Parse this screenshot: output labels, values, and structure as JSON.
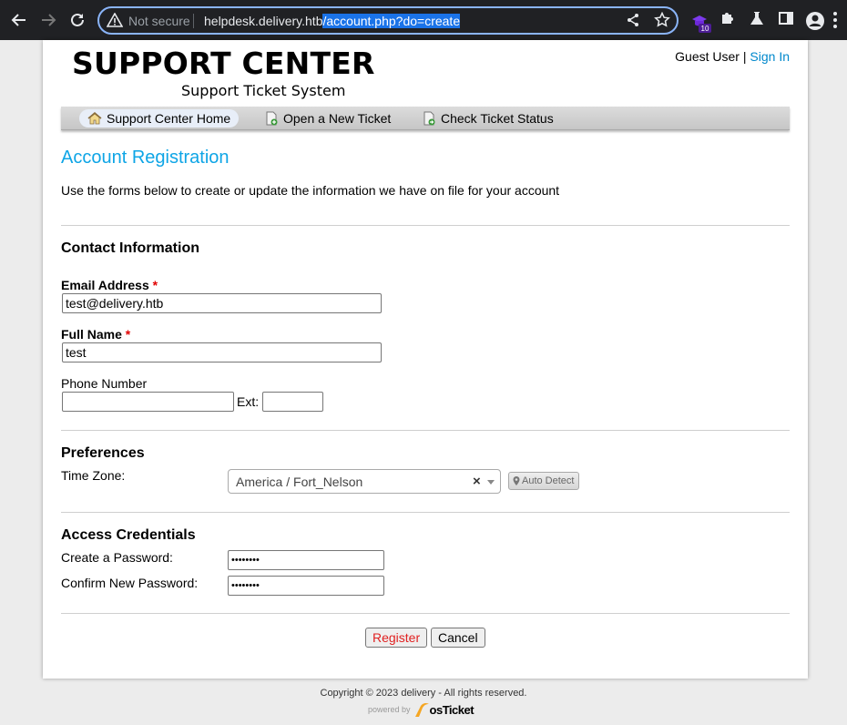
{
  "browser": {
    "security_label": "Not secure",
    "url_host": "helpdesk.delivery.htb",
    "url_path": "/account.php?do=create",
    "extension_badge": "10"
  },
  "header": {
    "logo_title": "SUPPORT CENTER",
    "logo_subtitle": "Support Ticket System",
    "guest_label": "Guest User",
    "separator": "|",
    "sign_in": "Sign In"
  },
  "nav": {
    "items": [
      {
        "label": "Support Center Home",
        "icon": "home-icon"
      },
      {
        "label": "Open a New Ticket",
        "icon": "new-ticket-icon"
      },
      {
        "label": "Check Ticket Status",
        "icon": "ticket-status-icon"
      }
    ]
  },
  "page": {
    "title": "Account Registration",
    "intro": "Use the forms below to create or update the information we have on file for your account"
  },
  "contact": {
    "heading": "Contact Information",
    "email_label": "Email Address",
    "email_value": "test@delivery.htb",
    "fullname_label": "Full Name",
    "fullname_value": "test",
    "phone_label": "Phone Number",
    "phone_value": "",
    "ext_label": "Ext:",
    "ext_value": "",
    "required_mark": "*"
  },
  "preferences": {
    "heading": "Preferences",
    "timezone_label": "Time Zone:",
    "timezone_value": "America / Fort_Nelson",
    "clear_glyph": "×",
    "auto_detect": "Auto Detect"
  },
  "credentials": {
    "heading": "Access Credentials",
    "password_label": "Create a Password:",
    "password_value": "••••••••",
    "confirm_label": "Confirm New Password:",
    "confirm_value": "••••••••"
  },
  "actions": {
    "register": "Register",
    "cancel": "Cancel"
  },
  "footer": {
    "copyright": "Copyright © 2023 delivery - All rights reserved.",
    "powered_by": "powered by",
    "brand": "osTicket"
  }
}
